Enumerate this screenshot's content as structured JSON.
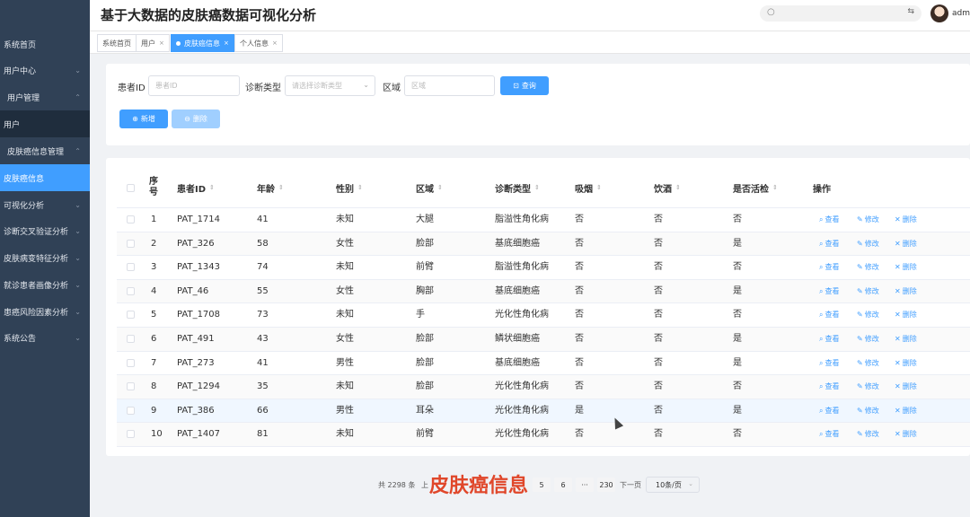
{
  "app": {
    "title": "基于大数据的皮肤癌数据可视化分析",
    "user_name": "admi"
  },
  "sidebar": {
    "items": [
      {
        "label": "系统首页",
        "chevron": ""
      },
      {
        "label": "用户中心",
        "chevron": "⌄"
      },
      {
        "label": "用户管理",
        "chevron": "⌃"
      },
      {
        "label": "用户",
        "chevron": ""
      },
      {
        "label": "皮肤癌信息管理",
        "chevron": "⌃"
      },
      {
        "label": "皮肤癌信息",
        "chevron": ""
      },
      {
        "label": "可视化分析",
        "chevron": "⌄"
      },
      {
        "label": "诊断交叉验证分析",
        "chevron": "⌄"
      },
      {
        "label": "皮肤病变特征分析",
        "chevron": "⌄"
      },
      {
        "label": "就诊患者画像分析",
        "chevron": "⌄"
      },
      {
        "label": "患癌风险因素分析",
        "chevron": "⌄"
      },
      {
        "label": "系统公告",
        "chevron": "⌄"
      }
    ]
  },
  "tabs": [
    {
      "label": "系统首页",
      "close": ""
    },
    {
      "label": "用户",
      "close": "×"
    },
    {
      "label": "皮肤癌信息",
      "close": "×"
    },
    {
      "label": "个人信息",
      "close": "×"
    }
  ],
  "filters": {
    "patient_id_label": "患者ID",
    "patient_id_placeholder": "患者ID",
    "diagnosis_label": "诊断类型",
    "diagnosis_placeholder": "请选择诊断类型",
    "region_label": "区域",
    "region_placeholder": "区域",
    "query_button": "查询",
    "add_button": "新增",
    "delete_button": "删除"
  },
  "table": {
    "columns": [
      "序号",
      "患者ID",
      "年龄",
      "性别",
      "区域",
      "诊断类型",
      "吸烟",
      "饮酒",
      "是否活检",
      "操作"
    ],
    "rows": [
      {
        "no": "1",
        "id": "PAT_1714",
        "age": "41",
        "sex": "未知",
        "region": "大腿",
        "diag": "脂溢性角化病",
        "smoke": "否",
        "drink": "否",
        "biopsy": "否"
      },
      {
        "no": "2",
        "id": "PAT_326",
        "age": "58",
        "sex": "女性",
        "region": "脸部",
        "diag": "基底细胞癌",
        "smoke": "否",
        "drink": "否",
        "biopsy": "是"
      },
      {
        "no": "3",
        "id": "PAT_1343",
        "age": "74",
        "sex": "未知",
        "region": "前臂",
        "diag": "脂溢性角化病",
        "smoke": "否",
        "drink": "否",
        "biopsy": "否"
      },
      {
        "no": "4",
        "id": "PAT_46",
        "age": "55",
        "sex": "女性",
        "region": "胸部",
        "diag": "基底细胞癌",
        "smoke": "否",
        "drink": "否",
        "biopsy": "是"
      },
      {
        "no": "5",
        "id": "PAT_1708",
        "age": "73",
        "sex": "未知",
        "region": "手",
        "diag": "光化性角化病",
        "smoke": "否",
        "drink": "否",
        "biopsy": "否"
      },
      {
        "no": "6",
        "id": "PAT_491",
        "age": "43",
        "sex": "女性",
        "region": "脸部",
        "diag": "鳞状细胞癌",
        "smoke": "否",
        "drink": "否",
        "biopsy": "是"
      },
      {
        "no": "7",
        "id": "PAT_273",
        "age": "41",
        "sex": "男性",
        "region": "脸部",
        "diag": "基底细胞癌",
        "smoke": "否",
        "drink": "否",
        "biopsy": "是"
      },
      {
        "no": "8",
        "id": "PAT_1294",
        "age": "35",
        "sex": "未知",
        "region": "脸部",
        "diag": "光化性角化病",
        "smoke": "否",
        "drink": "否",
        "biopsy": "否"
      },
      {
        "no": "9",
        "id": "PAT_386",
        "age": "66",
        "sex": "男性",
        "region": "耳朵",
        "diag": "光化性角化病",
        "smoke": "是",
        "drink": "否",
        "biopsy": "是"
      },
      {
        "no": "10",
        "id": "PAT_1407",
        "age": "81",
        "sex": "未知",
        "region": "前臂",
        "diag": "光化性角化病",
        "smoke": "否",
        "drink": "否",
        "biopsy": "否"
      }
    ],
    "actions": {
      "view": "查看",
      "edit": "修改",
      "delete": "删除"
    }
  },
  "pagination": {
    "total_text": "共 2298 条",
    "prev_partial": "上",
    "pages": [
      "5",
      "6",
      "···",
      "230"
    ],
    "next_label": "下一页",
    "page_size": "10条/页"
  },
  "overlay_caption": "皮肤癌信息"
}
